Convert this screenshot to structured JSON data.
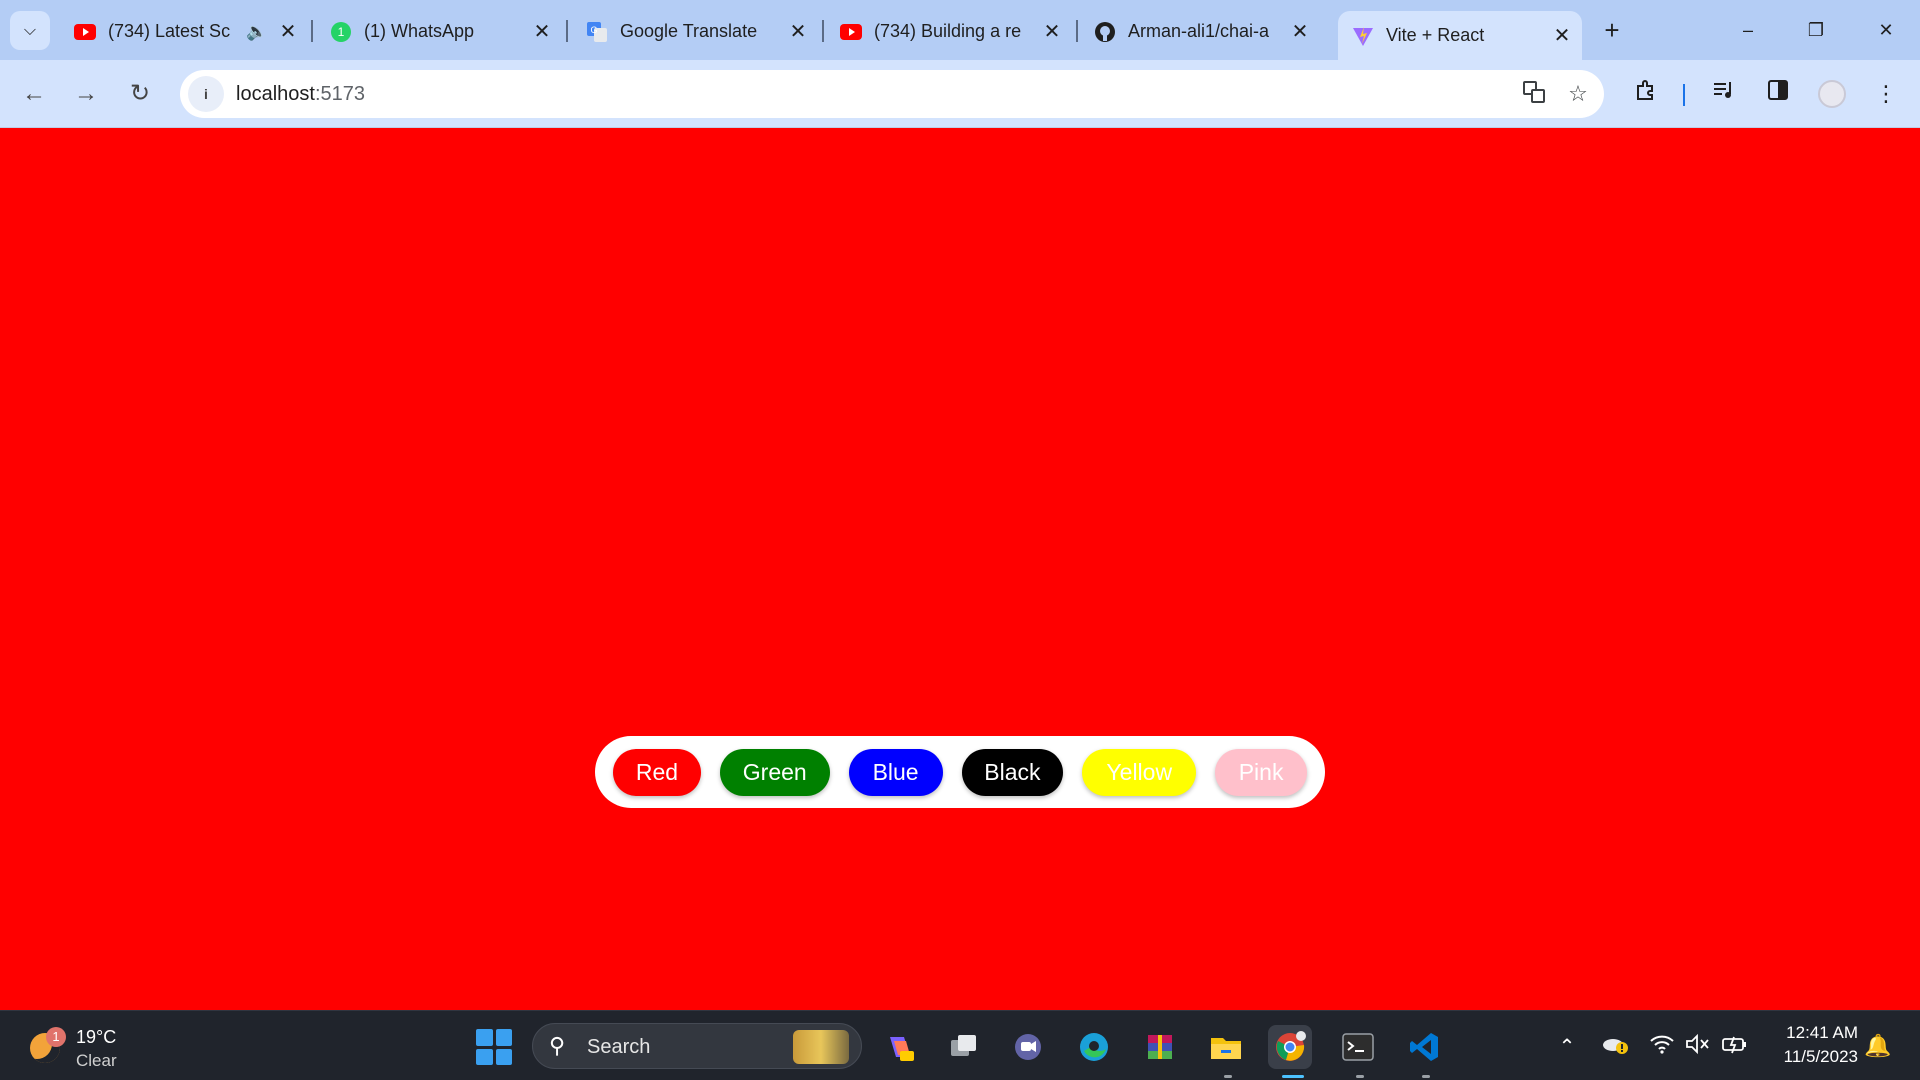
{
  "tabs": [
    {
      "title": "(734) Latest Sc",
      "favicon": "youtube-icon",
      "audio": true
    },
    {
      "title": "(1) WhatsApp",
      "favicon": "whatsapp-icon",
      "audio": false
    },
    {
      "title": "Google Translate",
      "favicon": "google-translate-icon",
      "audio": false
    },
    {
      "title": "(734) Building a re",
      "favicon": "youtube-icon",
      "audio": false
    },
    {
      "title": "Arman-ali1/chai-a",
      "favicon": "github-icon",
      "audio": false
    },
    {
      "title": "Vite + React",
      "favicon": "vite-icon",
      "audio": false,
      "active": true
    }
  ],
  "whatsapp_badge": "1",
  "address": {
    "host": "localhost",
    "port": ":5173"
  },
  "page": {
    "background": "#ff0000",
    "buttons": [
      {
        "label": "Red",
        "bg": "#ff0000",
        "fg": "#ffffff"
      },
      {
        "label": "Green",
        "bg": "#008000",
        "fg": "#ffffff"
      },
      {
        "label": "Blue",
        "bg": "#0000ff",
        "fg": "#ffffff"
      },
      {
        "label": "Black",
        "bg": "#000000",
        "fg": "#ffffff"
      },
      {
        "label": "Yellow",
        "bg": "#ffff00",
        "fg": "#ffffff"
      },
      {
        "label": "Pink",
        "bg": "#ffc0cb",
        "fg": "#ffffff"
      }
    ]
  },
  "taskbar": {
    "weather": {
      "temp": "19°C",
      "condition": "Clear",
      "badge": "1"
    },
    "search_label": "Search",
    "pinned_apps": [
      "copilot-icon",
      "task-view-icon",
      "teams-chat-icon",
      "edge-icon",
      "winrar-icon",
      "file-explorer-icon",
      "chrome-icon",
      "terminal-icon",
      "vscode-icon"
    ],
    "time": "12:41 AM",
    "date": "11/5/2023"
  }
}
